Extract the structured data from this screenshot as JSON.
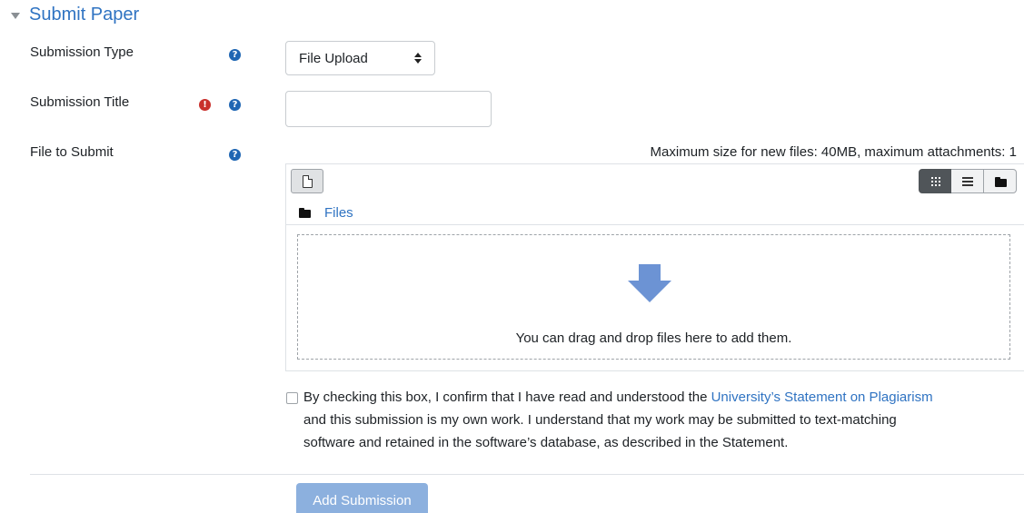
{
  "section": {
    "title": "Submit Paper"
  },
  "fields": {
    "submission_type": {
      "label": "Submission Type",
      "value": "File Upload"
    },
    "submission_title": {
      "label": "Submission Title",
      "value": "",
      "placeholder": ""
    },
    "file_to_submit": {
      "label": "File to Submit"
    }
  },
  "icons": {
    "help": "?",
    "required": "!"
  },
  "filemanager": {
    "max_size_text": "Maximum size for new files: 40MB, maximum attachments: 1",
    "path_label": "Files",
    "drop_text": "You can drag and drop files here to add them."
  },
  "statement": {
    "line1_before": "By checking this box, I confirm that I have read and understood the ",
    "link": "University’s Statement on Plagiarism",
    "line2": "and this submission is my own work. I understand that my work may be submitted to text-matching",
    "line3": "software and retained in the software’s database, as described in the Statement."
  },
  "actions": {
    "submit_label": "Add Submission"
  },
  "colors": {
    "link": "#2f73c2",
    "help_icon": "#1f66b3",
    "required_icon": "#c9302c",
    "submit_button": "#8cb0de",
    "drop_arrow": "#6c93d4"
  }
}
